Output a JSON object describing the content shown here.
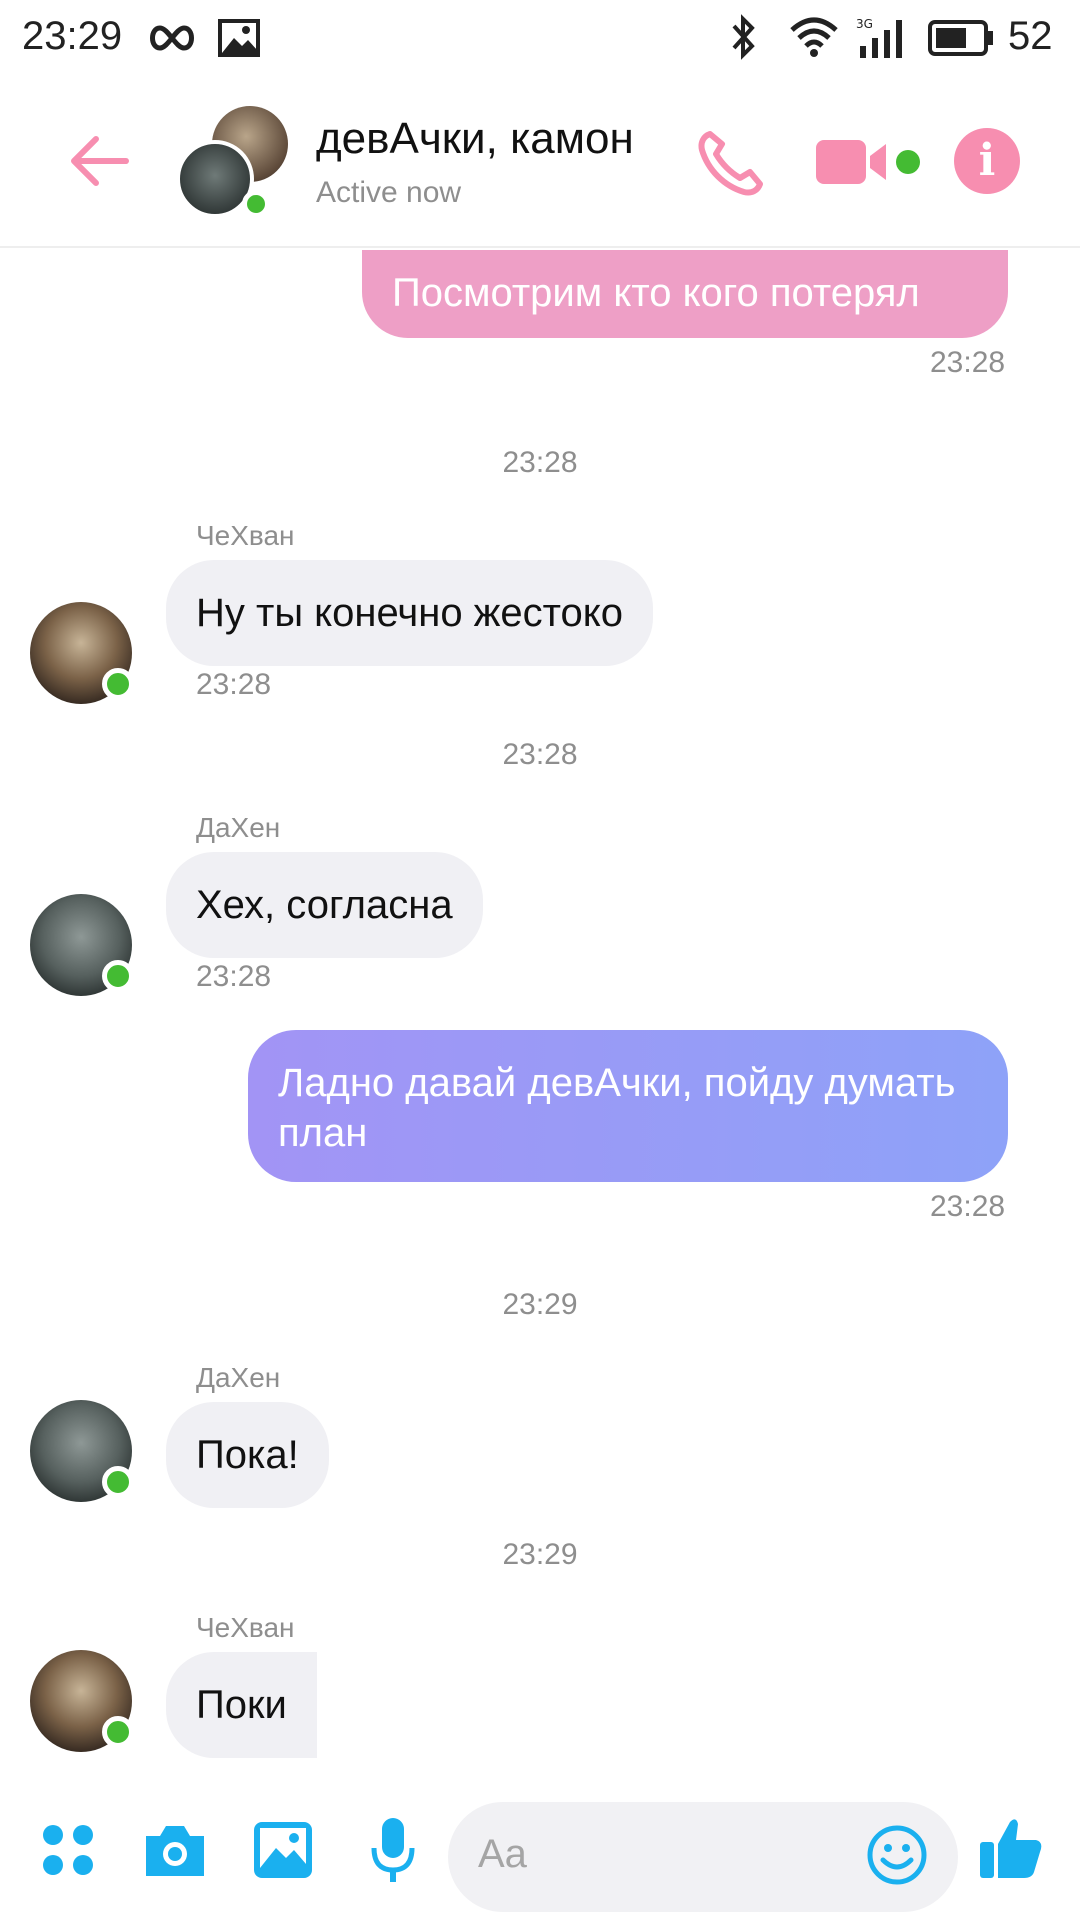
{
  "status_bar": {
    "time": "23:29",
    "battery": "52",
    "icons": [
      "infinity-icon",
      "image-icon",
      "bluetooth-icon",
      "wifi-icon",
      "signal-3g-icon",
      "battery-icon"
    ],
    "signal_label": "3G"
  },
  "header": {
    "title": "девАчки, камон",
    "status": "Active now",
    "accent_color": "#f78eb0"
  },
  "messages": {
    "m1": {
      "text": "Посмотрим кто кого потерял",
      "time": "23:28"
    },
    "sep1": "23:28",
    "m2": {
      "sender": "ЧеХван",
      "text": "Ну ты конечно жестоко",
      "time": "23:28"
    },
    "sep2": "23:28",
    "m3": {
      "sender": "ДаХен",
      "text": "Хех, согласна",
      "time": "23:28"
    },
    "m4": {
      "text": "Ладно давай девАчки, пойду думать план",
      "time": "23:28"
    },
    "sep3": "23:29",
    "m5": {
      "sender": "ДаХен",
      "text": "Пока!"
    },
    "sep4": "23:29",
    "m6": {
      "sender": "ЧеХван",
      "text": "Поки"
    }
  },
  "composer": {
    "placeholder": "Aa",
    "icons": [
      "apps-icon",
      "camera-icon",
      "gallery-icon",
      "microphone-icon",
      "emoji-icon",
      "thumbs-up-icon"
    ],
    "accent_color": "#1ab0ef"
  }
}
